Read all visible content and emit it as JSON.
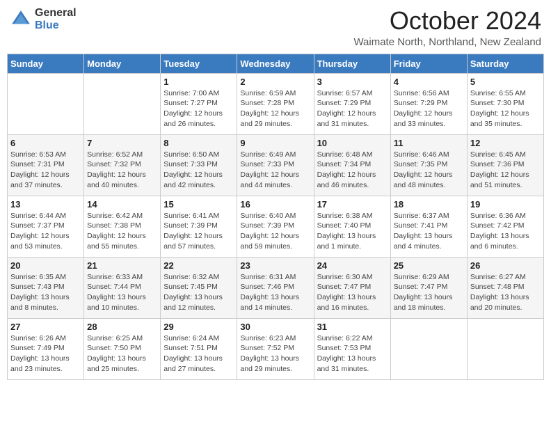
{
  "header": {
    "logo_general": "General",
    "logo_blue": "Blue",
    "month_title": "October 2024",
    "location": "Waimate North, Northland, New Zealand"
  },
  "days_of_week": [
    "Sunday",
    "Monday",
    "Tuesday",
    "Wednesday",
    "Thursday",
    "Friday",
    "Saturday"
  ],
  "weeks": [
    [
      {
        "day": "",
        "info": ""
      },
      {
        "day": "",
        "info": ""
      },
      {
        "day": "1",
        "info": "Sunrise: 7:00 AM\nSunset: 7:27 PM\nDaylight: 12 hours\nand 26 minutes."
      },
      {
        "day": "2",
        "info": "Sunrise: 6:59 AM\nSunset: 7:28 PM\nDaylight: 12 hours\nand 29 minutes."
      },
      {
        "day": "3",
        "info": "Sunrise: 6:57 AM\nSunset: 7:29 PM\nDaylight: 12 hours\nand 31 minutes."
      },
      {
        "day": "4",
        "info": "Sunrise: 6:56 AM\nSunset: 7:29 PM\nDaylight: 12 hours\nand 33 minutes."
      },
      {
        "day": "5",
        "info": "Sunrise: 6:55 AM\nSunset: 7:30 PM\nDaylight: 12 hours\nand 35 minutes."
      }
    ],
    [
      {
        "day": "6",
        "info": "Sunrise: 6:53 AM\nSunset: 7:31 PM\nDaylight: 12 hours\nand 37 minutes."
      },
      {
        "day": "7",
        "info": "Sunrise: 6:52 AM\nSunset: 7:32 PM\nDaylight: 12 hours\nand 40 minutes."
      },
      {
        "day": "8",
        "info": "Sunrise: 6:50 AM\nSunset: 7:33 PM\nDaylight: 12 hours\nand 42 minutes."
      },
      {
        "day": "9",
        "info": "Sunrise: 6:49 AM\nSunset: 7:33 PM\nDaylight: 12 hours\nand 44 minutes."
      },
      {
        "day": "10",
        "info": "Sunrise: 6:48 AM\nSunset: 7:34 PM\nDaylight: 12 hours\nand 46 minutes."
      },
      {
        "day": "11",
        "info": "Sunrise: 6:46 AM\nSunset: 7:35 PM\nDaylight: 12 hours\nand 48 minutes."
      },
      {
        "day": "12",
        "info": "Sunrise: 6:45 AM\nSunset: 7:36 PM\nDaylight: 12 hours\nand 51 minutes."
      }
    ],
    [
      {
        "day": "13",
        "info": "Sunrise: 6:44 AM\nSunset: 7:37 PM\nDaylight: 12 hours\nand 53 minutes."
      },
      {
        "day": "14",
        "info": "Sunrise: 6:42 AM\nSunset: 7:38 PM\nDaylight: 12 hours\nand 55 minutes."
      },
      {
        "day": "15",
        "info": "Sunrise: 6:41 AM\nSunset: 7:39 PM\nDaylight: 12 hours\nand 57 minutes."
      },
      {
        "day": "16",
        "info": "Sunrise: 6:40 AM\nSunset: 7:39 PM\nDaylight: 12 hours\nand 59 minutes."
      },
      {
        "day": "17",
        "info": "Sunrise: 6:38 AM\nSunset: 7:40 PM\nDaylight: 13 hours\nand 1 minute."
      },
      {
        "day": "18",
        "info": "Sunrise: 6:37 AM\nSunset: 7:41 PM\nDaylight: 13 hours\nand 4 minutes."
      },
      {
        "day": "19",
        "info": "Sunrise: 6:36 AM\nSunset: 7:42 PM\nDaylight: 13 hours\nand 6 minutes."
      }
    ],
    [
      {
        "day": "20",
        "info": "Sunrise: 6:35 AM\nSunset: 7:43 PM\nDaylight: 13 hours\nand 8 minutes."
      },
      {
        "day": "21",
        "info": "Sunrise: 6:33 AM\nSunset: 7:44 PM\nDaylight: 13 hours\nand 10 minutes."
      },
      {
        "day": "22",
        "info": "Sunrise: 6:32 AM\nSunset: 7:45 PM\nDaylight: 13 hours\nand 12 minutes."
      },
      {
        "day": "23",
        "info": "Sunrise: 6:31 AM\nSunset: 7:46 PM\nDaylight: 13 hours\nand 14 minutes."
      },
      {
        "day": "24",
        "info": "Sunrise: 6:30 AM\nSunset: 7:47 PM\nDaylight: 13 hours\nand 16 minutes."
      },
      {
        "day": "25",
        "info": "Sunrise: 6:29 AM\nSunset: 7:47 PM\nDaylight: 13 hours\nand 18 minutes."
      },
      {
        "day": "26",
        "info": "Sunrise: 6:27 AM\nSunset: 7:48 PM\nDaylight: 13 hours\nand 20 minutes."
      }
    ],
    [
      {
        "day": "27",
        "info": "Sunrise: 6:26 AM\nSunset: 7:49 PM\nDaylight: 13 hours\nand 23 minutes."
      },
      {
        "day": "28",
        "info": "Sunrise: 6:25 AM\nSunset: 7:50 PM\nDaylight: 13 hours\nand 25 minutes."
      },
      {
        "day": "29",
        "info": "Sunrise: 6:24 AM\nSunset: 7:51 PM\nDaylight: 13 hours\nand 27 minutes."
      },
      {
        "day": "30",
        "info": "Sunrise: 6:23 AM\nSunset: 7:52 PM\nDaylight: 13 hours\nand 29 minutes."
      },
      {
        "day": "31",
        "info": "Sunrise: 6:22 AM\nSunset: 7:53 PM\nDaylight: 13 hours\nand 31 minutes."
      },
      {
        "day": "",
        "info": ""
      },
      {
        "day": "",
        "info": ""
      }
    ]
  ]
}
